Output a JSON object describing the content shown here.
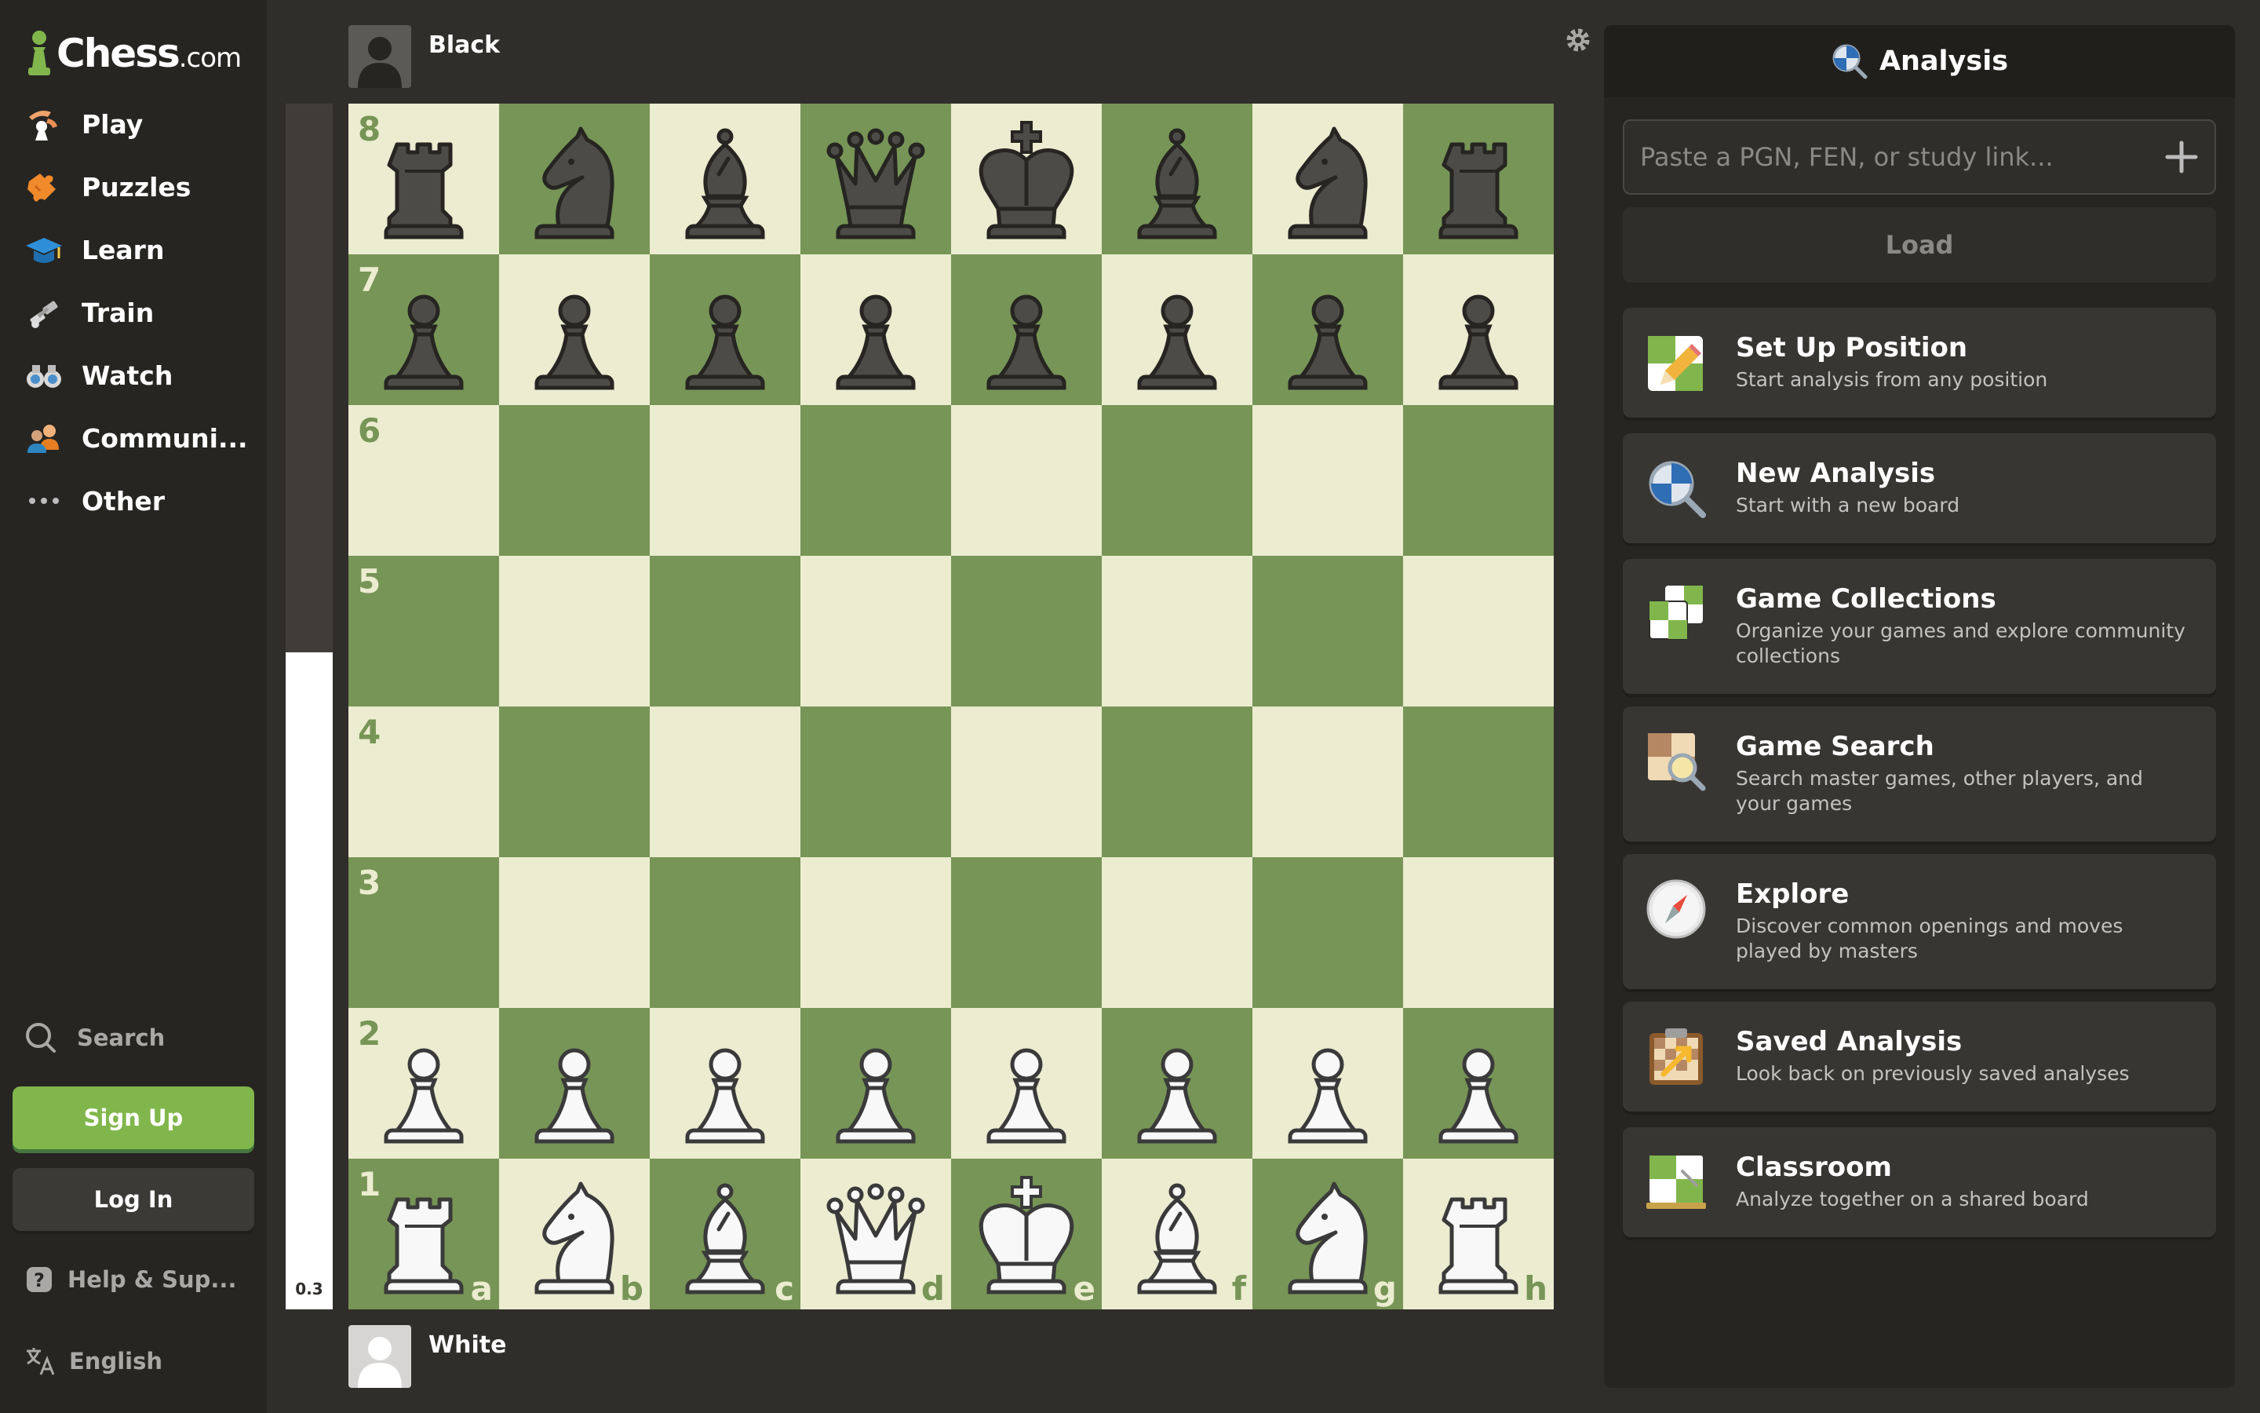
{
  "sidebar": {
    "logo": {
      "word": "Chess",
      "suffix": ".com"
    },
    "items": [
      {
        "label": "Play",
        "icon": "play-icon"
      },
      {
        "label": "Puzzles",
        "icon": "puzzles-icon"
      },
      {
        "label": "Learn",
        "icon": "learn-icon"
      },
      {
        "label": "Train",
        "icon": "train-icon"
      },
      {
        "label": "Watch",
        "icon": "watch-icon"
      },
      {
        "label": "Communi...",
        "icon": "community-icon"
      },
      {
        "label": "Other",
        "icon": "more-icon"
      }
    ],
    "search_label": "Search",
    "signup_label": "Sign Up",
    "login_label": "Log In",
    "help_label": "Help & Sup...",
    "language_label": "English"
  },
  "players": {
    "top": {
      "name": "Black"
    },
    "bottom": {
      "name": "White"
    }
  },
  "eval": {
    "score": "0.3",
    "white_fraction": 0.545
  },
  "board": {
    "ranks": [
      "8",
      "7",
      "6",
      "5",
      "4",
      "3",
      "2",
      "1"
    ],
    "files": [
      "a",
      "b",
      "c",
      "d",
      "e",
      "f",
      "g",
      "h"
    ],
    "fen": "rnbqkbnr/pppppppp/8/8/8/8/PPPPPPPP/RNBQKBNR",
    "light_color": "#ebecd0",
    "dark_color": "#779556"
  },
  "panel": {
    "title": "Analysis",
    "pgn_placeholder": "Paste a PGN, FEN, or study link...",
    "load_label": "Load",
    "cards": [
      {
        "title": "Set Up Position",
        "desc": "Start analysis from any position",
        "icon": "setup-position-icon"
      },
      {
        "title": "New Analysis",
        "desc": "Start with a new board",
        "icon": "new-analysis-icon"
      },
      {
        "title": "Game Collections",
        "desc": "Organize your games and explore community collections",
        "icon": "game-collections-icon"
      },
      {
        "title": "Game Search",
        "desc": "Search master games, other players, and your games",
        "icon": "game-search-icon"
      },
      {
        "title": "Explore",
        "desc": "Discover common openings and moves played by masters",
        "icon": "explore-icon"
      },
      {
        "title": "Saved Analysis",
        "desc": "Look back on previously saved analyses",
        "icon": "saved-analysis-icon"
      },
      {
        "title": "Classroom",
        "desc": "Analyze together on a shared board",
        "icon": "classroom-icon"
      }
    ]
  }
}
